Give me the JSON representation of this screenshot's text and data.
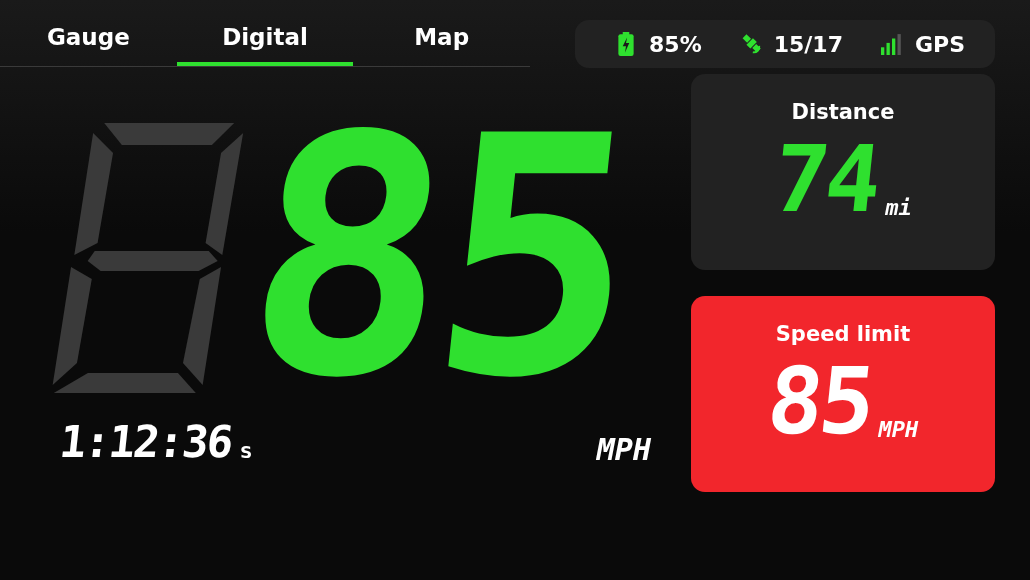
{
  "tabs": [
    {
      "label": "Gauge",
      "selected": false
    },
    {
      "label": "Digital",
      "selected": true
    },
    {
      "label": "Map",
      "selected": false
    }
  ],
  "status": [
    {
      "kind": "battery",
      "text": "85%"
    },
    {
      "kind": "satellite",
      "text": "15/17"
    },
    {
      "kind": "signal",
      "text": "GPS"
    }
  ],
  "speed": {
    "value": "85",
    "unit": "MPH"
  },
  "timer": {
    "value": "1:12:36",
    "unit": "s"
  },
  "distance": {
    "title": "Distance",
    "value": "74",
    "unit": "mi"
  },
  "speed_limit": {
    "title": "Speed limit",
    "value": "85",
    "unit": "MPH",
    "alert": true
  }
}
